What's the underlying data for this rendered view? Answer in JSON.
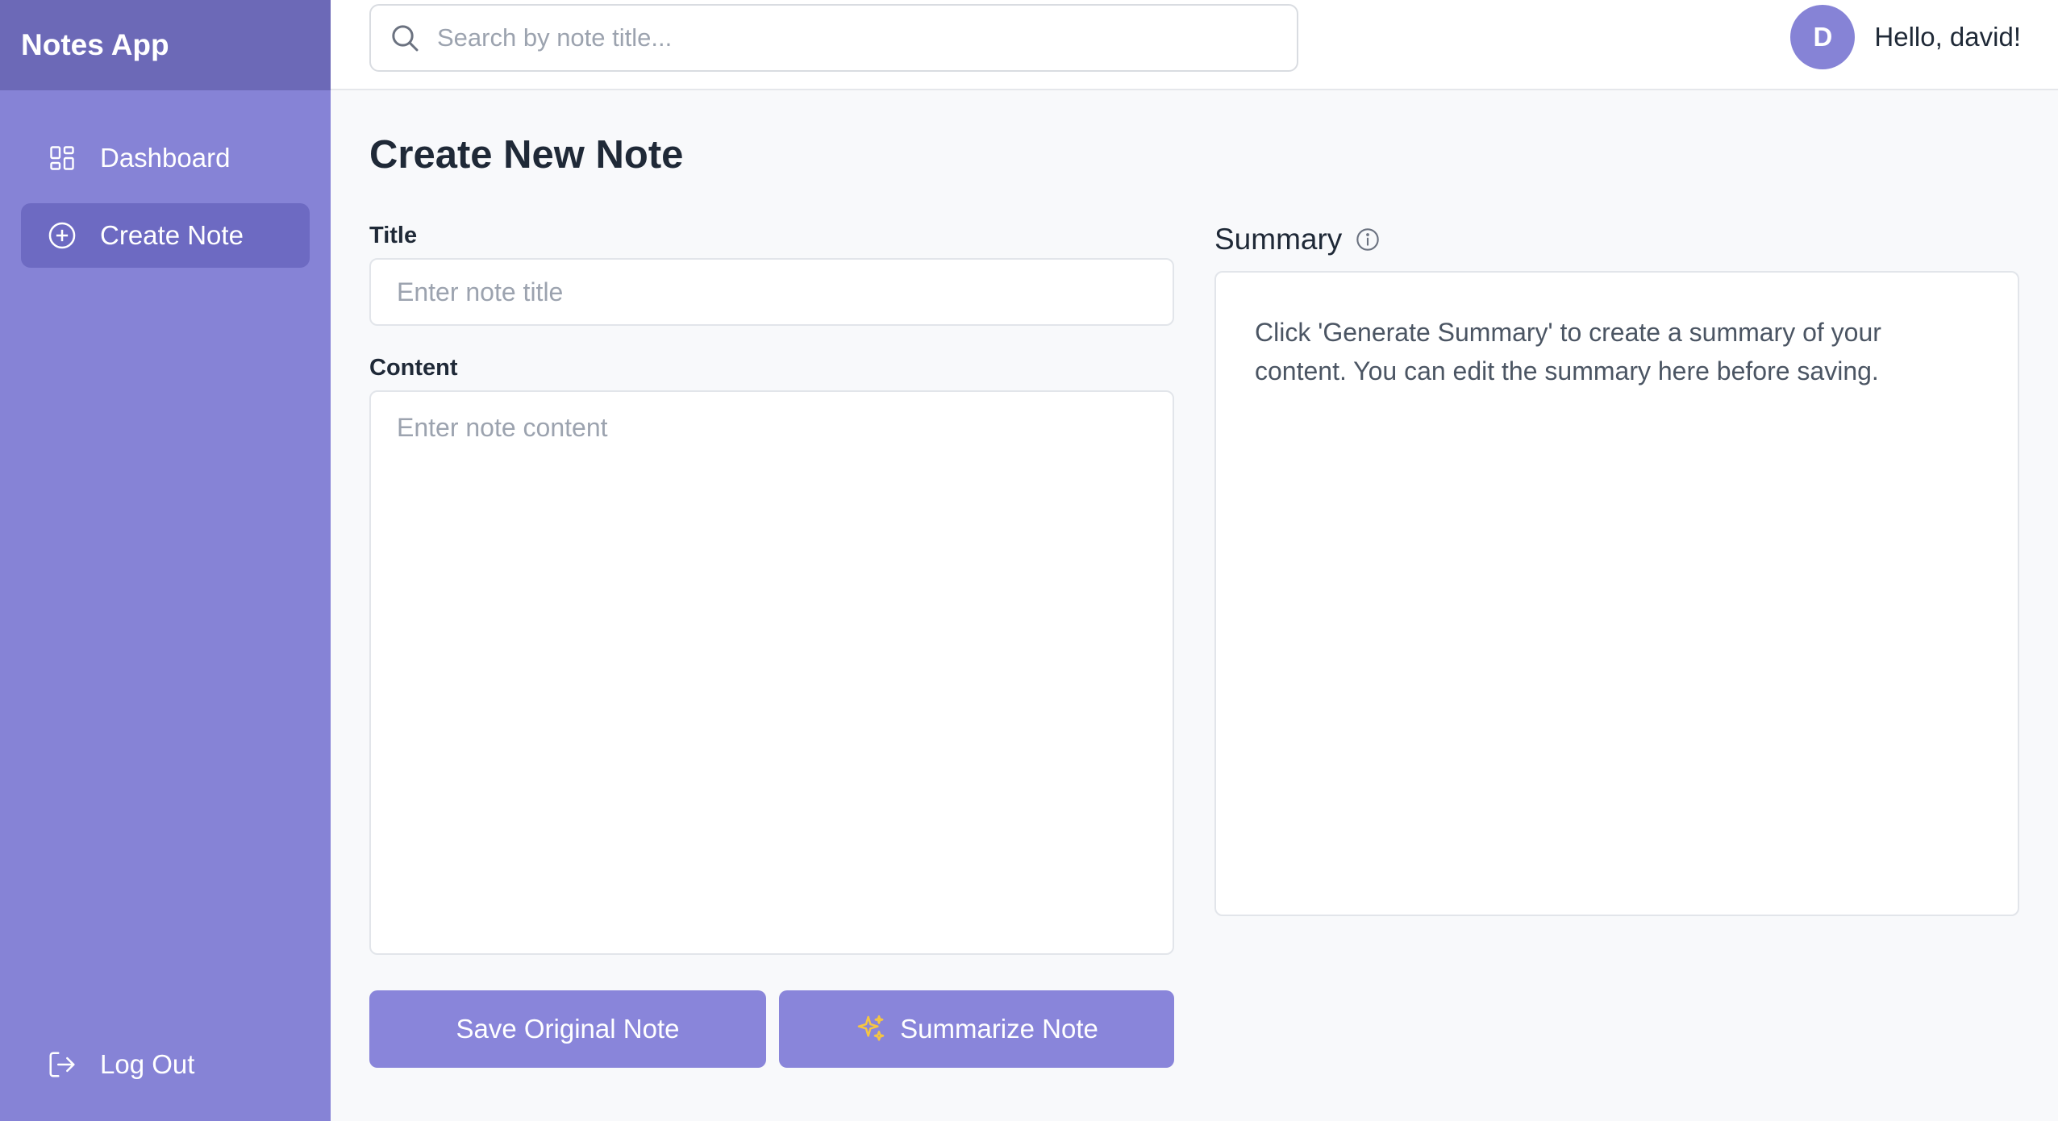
{
  "sidebar": {
    "brand": "Notes App",
    "items": [
      {
        "label": "Dashboard",
        "icon": "dashboard-icon",
        "active": false
      },
      {
        "label": "Create Note",
        "icon": "plus-circle-icon",
        "active": true
      }
    ],
    "logout_label": "Log Out",
    "logout_icon": "logout-icon"
  },
  "header": {
    "search": {
      "placeholder": "Search by note title...",
      "value": ""
    },
    "avatar_initial": "D",
    "greeting": "Hello, david!"
  },
  "main": {
    "page_title": "Create New Note",
    "title_label": "Title",
    "title_placeholder": "Enter note title",
    "content_label": "Content",
    "content_placeholder": "Enter note content",
    "save_button": "Save Original Note",
    "summarize_button": "Summarize Note",
    "summary_title": "Summary",
    "summary_text": "Click 'Generate Summary' to create a summary of your content. You can edit the summary here before saving."
  },
  "colors": {
    "sidebar": "#8683d6",
    "brand_bar": "#6c69b7",
    "active_item": "#6d6ac2",
    "button": "#8985da",
    "sparkle": "#f5c542"
  }
}
